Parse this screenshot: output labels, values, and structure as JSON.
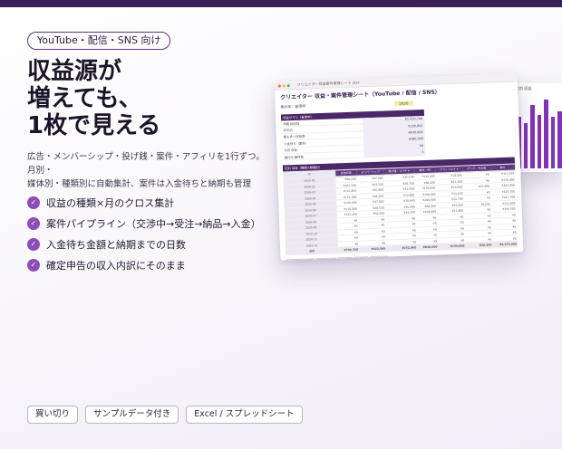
{
  "badge": "YouTube・配信・SNS 向け",
  "headline": [
    "収益源が",
    "増えても、",
    "1枚で見える"
  ],
  "description": [
    "広告・メンバーシップ・投げ銭・案件・アフィリを1行ずつ。月別・",
    "媒体別・種類別に自動集計、案件は入金待ちと納期も管理"
  ],
  "features": [
    {
      "icon": "check-icon",
      "label": "収益の種類×月のクロス集計"
    },
    {
      "icon": "check-icon",
      "label": "案件パイプライン（交渉中→受注→納品→入金）"
    },
    {
      "icon": "check-icon",
      "label": "入金待ち金額と納期までの日数"
    },
    {
      "icon": "check-icon",
      "label": "確定申告の収入内訳にそのまま"
    }
  ],
  "tags": [
    "買い切り",
    "サンプルデータ付き",
    "Excel / スプレッドシート"
  ],
  "colors": {
    "accent": "#8d4db8",
    "dark": "#3b2156",
    "header": "#4a2868"
  },
  "screenshot": {
    "window_title": "クリエイター収益案件管理シート.xlsx",
    "sheet_title": "クリエイター 収益・案件管理シート（YouTube / 配信 / SNS）",
    "filter_label": "集計年：基準年",
    "year": "2026",
    "summary_header": "収益サマリ（基準年）",
    "summary": [
      {
        "label": "年間 総収益",
        "value": "¥2,410,700"
      },
      {
        "label": "月平均",
        "value": "¥200,892"
      },
      {
        "label": "最も多い収益源",
        "value": "¥830,000"
      },
      {
        "label": "入金待ち（案件）",
        "value": "¥380,000"
      },
      {
        "label": "今月 収益",
        "value": "¥0"
      },
      {
        "label": "進行中 案件数",
        "value": "3"
      }
    ],
    "matrix_caption": "月別 収益（種類×期間別）",
    "matrix_headers": [
      "月",
      "広告収益",
      "メンバーシップ",
      "投げ銭・スパチャ",
      "案件・PR",
      "アフィリエイト",
      "グッズ・その他",
      "合計"
    ],
    "matrix_rows": [
      [
        "2026-01",
        "¥98,200",
        "¥42,000",
        "¥35,100",
        "¥120,000",
        "¥18,400",
        "¥0",
        "¥313,700"
      ],
      [
        "2026-02",
        "¥102,500",
        "¥43,500",
        "¥28,700",
        "¥80,000",
        "¥21,300",
        "¥0",
        "¥276,000"
      ],
      [
        "2026-03",
        "¥115,800",
        "¥45,000",
        "¥41,200",
        "¥150,000",
        "¥19,900",
        "¥12,000",
        "¥383,900"
      ],
      [
        "2026-04",
        "¥121,300",
        "¥46,500",
        "¥33,800",
        "¥100,000",
        "¥24,100",
        "¥0",
        "¥325,700"
      ],
      [
        "2026-05",
        "¥109,600",
        "¥47,000",
        "¥38,400",
        "¥200,000",
        "¥22,700",
        "¥0",
        "¥417,700"
      ],
      [
        "2026-06",
        "¥118,900",
        "¥48,500",
        "¥30,900",
        "¥80,000",
        "¥25,600",
        "¥8,500",
        "¥312,400"
      ],
      [
        "2026-07",
        "¥126,400",
        "¥50,000",
        "¥44,300",
        "¥100,000",
        "¥23,800",
        "¥0",
        "¥344,500"
      ],
      [
        "2026-08",
        "¥0",
        "¥0",
        "¥0",
        "¥0",
        "¥0",
        "¥0",
        "¥0"
      ],
      [
        "2026-09",
        "¥0",
        "¥0",
        "¥0",
        "¥0",
        "¥0",
        "¥0",
        "¥0"
      ],
      [
        "2026-10",
        "¥0",
        "¥0",
        "¥0",
        "¥0",
        "¥0",
        "¥0",
        "¥0"
      ],
      [
        "2026-11",
        "¥0",
        "¥0",
        "¥0",
        "¥0",
        "¥0",
        "¥0",
        "¥0"
      ],
      [
        "2026-12",
        "¥0",
        "¥0",
        "¥0",
        "¥0",
        "¥0",
        "¥0",
        "¥0"
      ]
    ],
    "matrix_total": [
      "合計",
      "¥792,700",
      "¥322,500",
      "¥252,400",
      "¥830,000",
      "¥155,800",
      "¥20,500",
      "¥2,373,900"
    ],
    "sheet_tabs": [
      "ダッシュボード",
      "収益入力",
      "案件",
      "設定",
      "使い方"
    ],
    "side_chart": {
      "title": "月別 収益",
      "values": [
        313700,
        276000,
        383900,
        325700,
        417700,
        312400,
        344500
      ]
    }
  }
}
